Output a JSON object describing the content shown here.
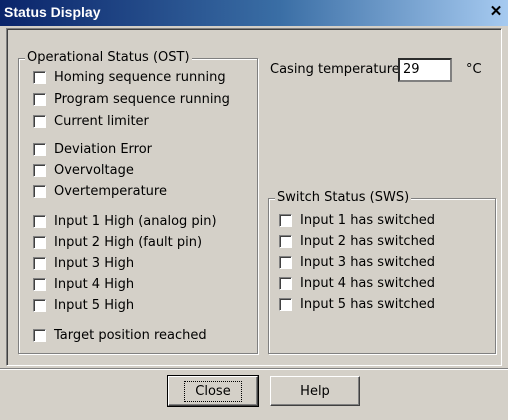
{
  "window": {
    "title": "Status Display",
    "close_glyph": "✕"
  },
  "ost": {
    "label": "Operational Status (OST)",
    "items": [
      "Homing sequence running",
      "Program sequence running",
      "Current limiter",
      "Deviation Error",
      "Overvoltage",
      "Overtemperature",
      "Input 1 High (analog pin)",
      "Input 2 High (fault pin)",
      "Input 3 High",
      "Input 4 High",
      "Input 5 High",
      "Target position reached"
    ]
  },
  "temperature": {
    "label": "Casing temperature:",
    "value": "29",
    "unit": "°C"
  },
  "sws": {
    "label": "Switch Status (SWS)",
    "items": [
      "Input 1 has switched",
      "Input 2 has switched",
      "Input 3 has switched",
      "Input 4 has switched",
      "Input 5 has switched"
    ]
  },
  "buttons": {
    "close": "Close",
    "help": "Help"
  }
}
